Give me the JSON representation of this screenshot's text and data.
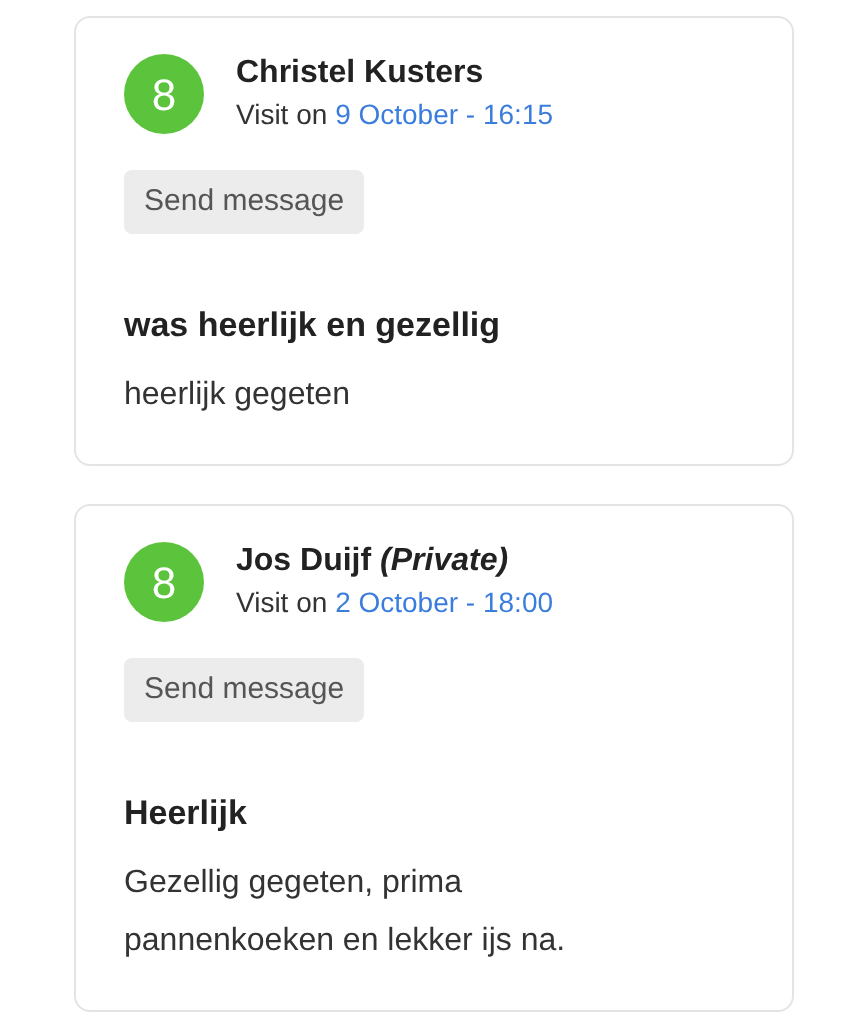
{
  "reviews": [
    {
      "score": "8",
      "name": "Christel Kusters",
      "visit_prefix": "Visit on",
      "visit_date": "9 October - 16:15",
      "button": "Send message",
      "title": "was heerlijk en gezellig",
      "body": "heerlijk gegeten"
    },
    {
      "score": "8",
      "name": "Jos Duijf *(Private)*",
      "visit_prefix": "Visit on",
      "visit_date": "2 October - 18:00",
      "button": "Send message",
      "title": "Heerlijk",
      "body": "Gezellig gegeten, prima pannenkoeken en lekker ijs na."
    }
  ]
}
